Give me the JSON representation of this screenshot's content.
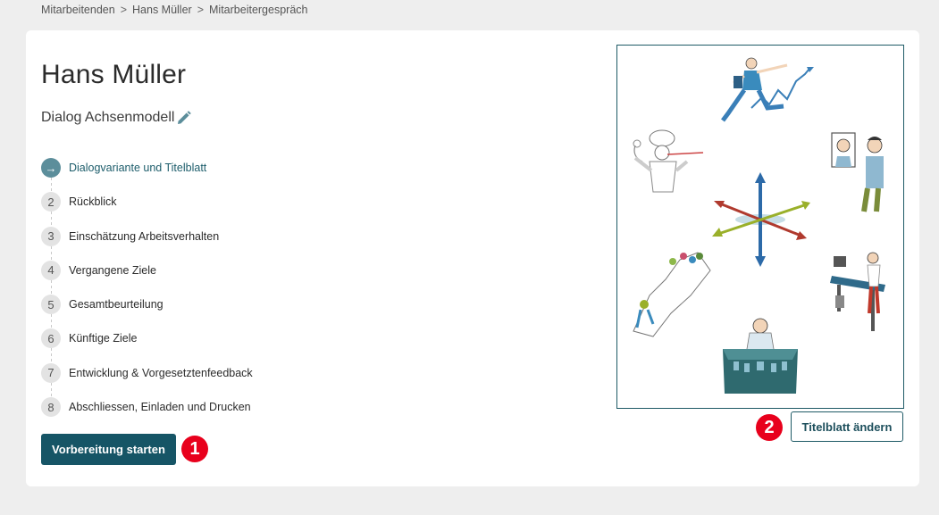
{
  "breadcrumb": {
    "items": [
      "Mitarbeitenden",
      "Hans Müller",
      "Mitarbeitergespräch"
    ],
    "separator": ">"
  },
  "header": {
    "title": "Hans Müller",
    "subtitle": "Dialog Achsenmodell"
  },
  "steps": [
    {
      "num": "→",
      "label": "Dialogvariante und Titelblatt",
      "active": true
    },
    {
      "num": "2",
      "label": "Rückblick"
    },
    {
      "num": "3",
      "label": "Einschätzung Arbeitsverhalten"
    },
    {
      "num": "4",
      "label": "Vergangene Ziele"
    },
    {
      "num": "5",
      "label": "Gesamtbeurteilung"
    },
    {
      "num": "6",
      "label": "Künftige Ziele"
    },
    {
      "num": "7",
      "label": "Entwicklung & Vorgesetztenfeedback"
    },
    {
      "num": "8",
      "label": "Abschliessen, Einladen und Drucken"
    }
  ],
  "actions": {
    "start_label": "Vorbereitung starten",
    "change_cover_label": "Titelblatt ändern"
  },
  "annotations": {
    "badge1": "1",
    "badge2": "2"
  },
  "colors": {
    "primary": "#165566",
    "active_step": "#5c8e9b",
    "badge": "#e8001c",
    "pencil": "#5c8e9b"
  },
  "icons": {
    "edit": "pencil-icon",
    "active_step": "arrow-right-icon"
  }
}
